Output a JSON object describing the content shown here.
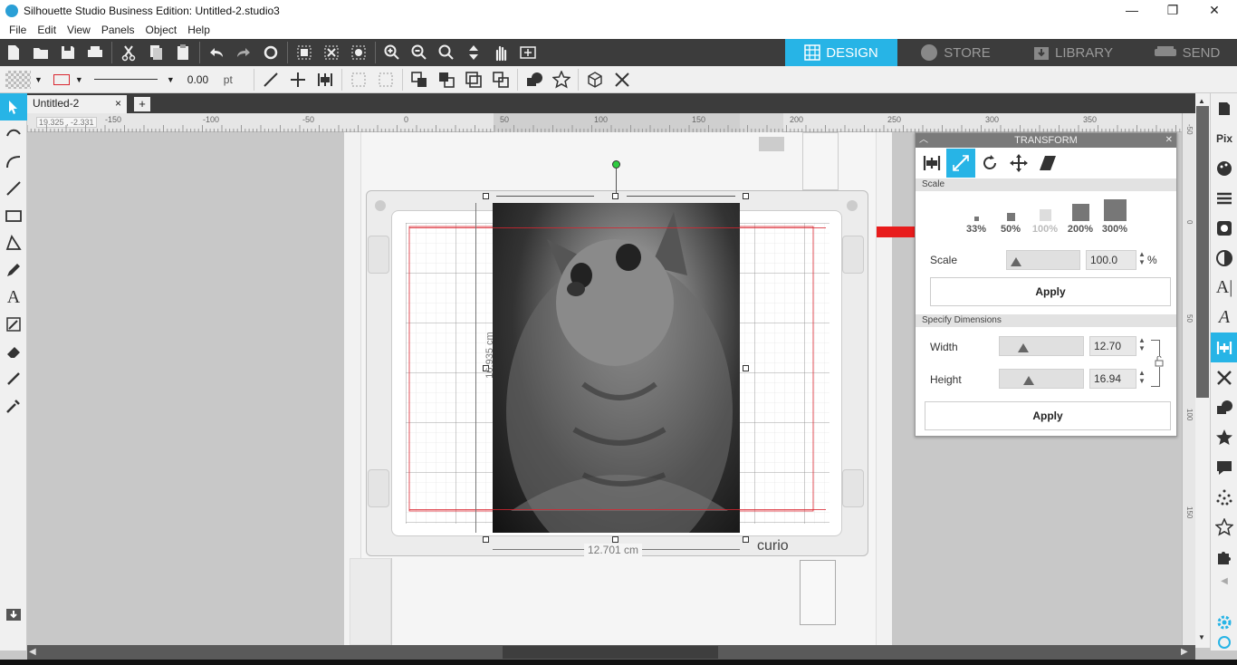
{
  "window": {
    "title": "Silhouette Studio Business Edition: Untitled-2.studio3",
    "minimize": "—",
    "maximize": "❐",
    "close": "✕"
  },
  "menu": [
    "File",
    "Edit",
    "View",
    "Panels",
    "Object",
    "Help"
  ],
  "nav_tabs": [
    {
      "label": "DESIGN",
      "active": true
    },
    {
      "label": "STORE",
      "active": false
    },
    {
      "label": "LIBRARY",
      "active": false
    },
    {
      "label": "SEND",
      "active": false
    }
  ],
  "toolbar2": {
    "line_width_value": "0.00",
    "line_width_unit": "pt"
  },
  "document_tab": {
    "name": "Untitled-2",
    "close": "×",
    "add": "+"
  },
  "coord_readout": "19.325 , -2.331",
  "ruler_top_labels": [
    "-150",
    "-100",
    "-50",
    "0",
    "50",
    "100",
    "150",
    "200",
    "250",
    "300",
    "350"
  ],
  "ruler_right_labels": [
    "-50",
    "0",
    "50",
    "100",
    "150"
  ],
  "canvas": {
    "height_dim": "16.935 cm",
    "width_dim": "12.701 cm",
    "machine_label": "curio"
  },
  "transform_panel": {
    "title": "TRANSFORM",
    "close": "✕",
    "scale_section": "Scale",
    "presets": [
      {
        "label": "33%",
        "disabled": false
      },
      {
        "label": "50%",
        "disabled": false
      },
      {
        "label": "100%",
        "disabled": true
      },
      {
        "label": "200%",
        "disabled": false
      },
      {
        "label": "300%",
        "disabled": false
      }
    ],
    "scale_label": "Scale",
    "scale_value": "100.0",
    "scale_unit": "%",
    "apply_label": "Apply",
    "dimensions_section": "Specify Dimensions",
    "width_label": "Width",
    "width_value": "12.70",
    "height_label": "Height",
    "height_value": "16.94",
    "apply2_label": "Apply"
  },
  "colors": {
    "accent": "#27b4e6",
    "toolbar_dark": "#3c3c3c",
    "arrow_red": "#e81c1c",
    "cut_line": "#d9262f"
  }
}
